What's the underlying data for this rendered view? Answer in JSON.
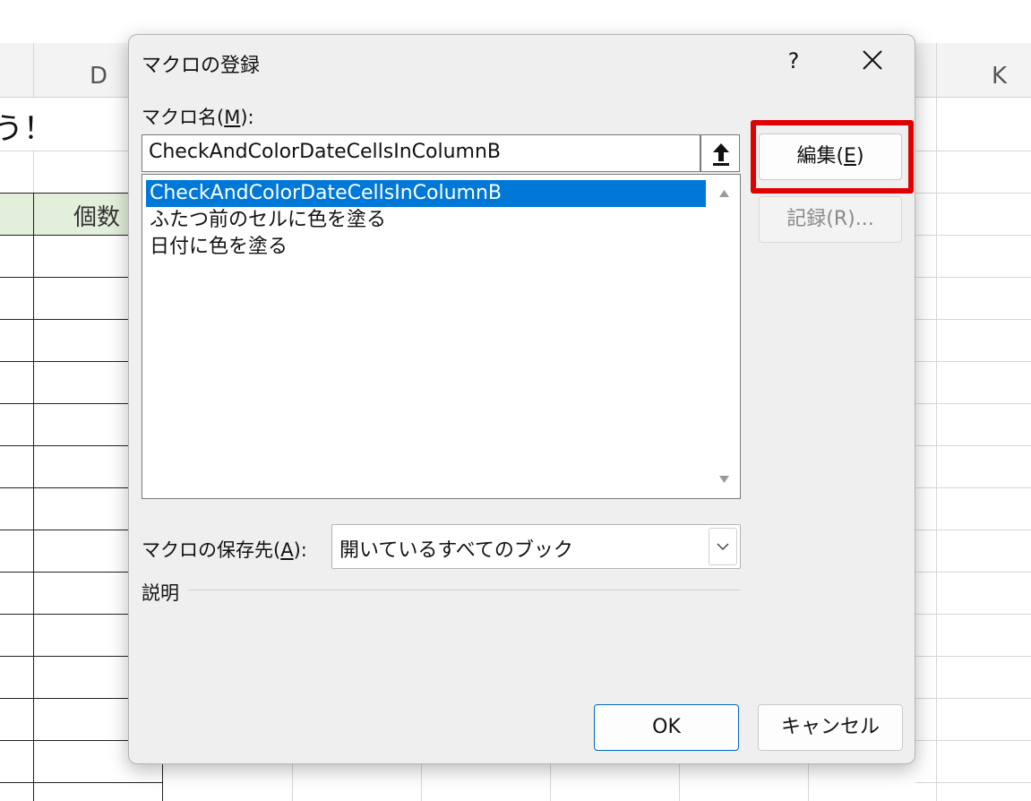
{
  "sheet": {
    "columns": [
      "D",
      "K"
    ],
    "title_fragment": "う！",
    "header_cell": "個数"
  },
  "dialog": {
    "title": "マクロの登録",
    "help_label": "?",
    "macro_name_label": "マクロ名(",
    "macro_name_key": "M",
    "macro_name_label_end": "):",
    "macro_name_value": "CheckAndColorDateCellsInColumnB",
    "macros": [
      "CheckAndColorDateCellsInColumnB",
      "ふたつ前のセルに色を塗る",
      "日付に色を塗る"
    ],
    "selected_index": 0,
    "edit_label": "編集(",
    "edit_key": "E",
    "edit_label_end": ")",
    "record_label": "記録(R)...",
    "save_location_label": "マクロの保存先(",
    "save_location_key": "A",
    "save_location_label_end": "):",
    "save_location_value": "開いているすべてのブック",
    "description_label": "説明",
    "ok_label": "OK",
    "cancel_label": "キャンセル",
    "highlight_color": "#e00000",
    "selection_color": "#0078d7"
  }
}
